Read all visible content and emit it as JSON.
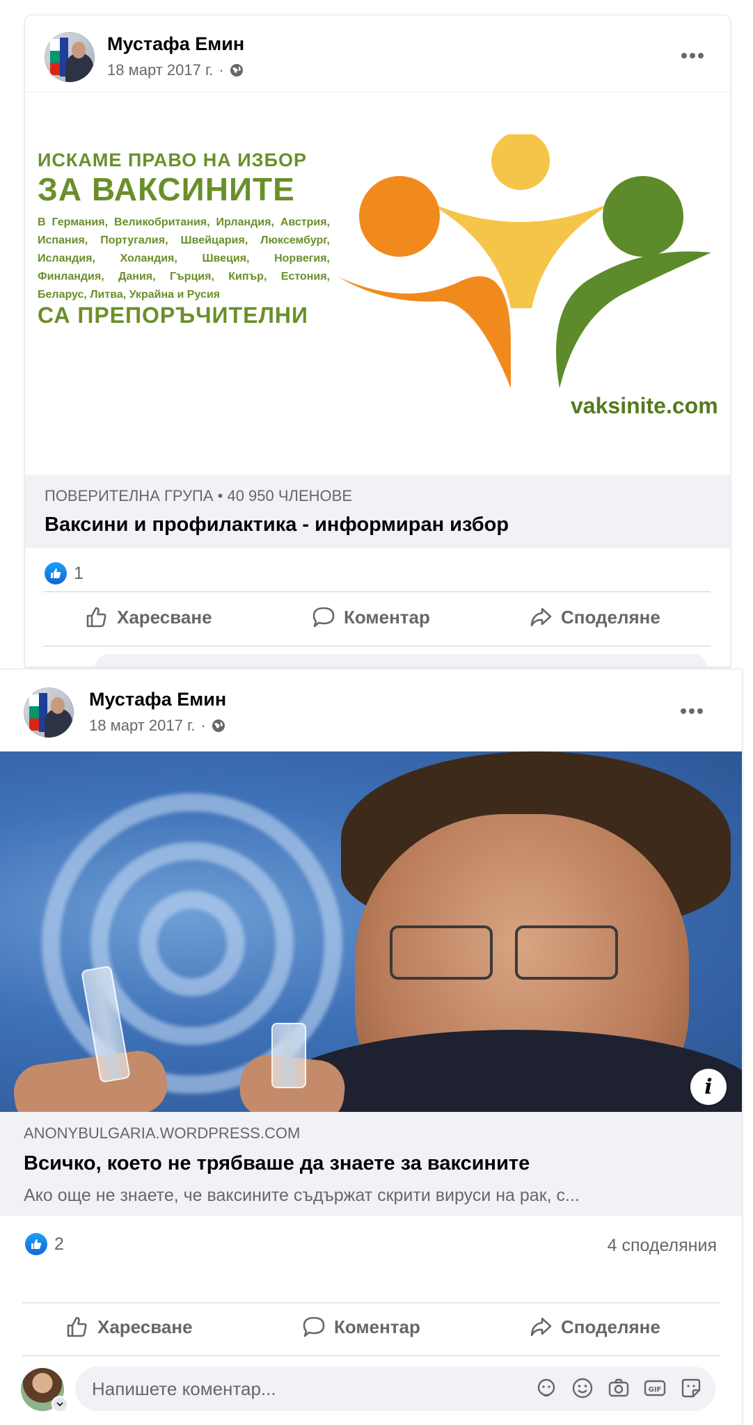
{
  "post1": {
    "author": "Мустафа Емин",
    "date": "18 март 2017 г.",
    "separator": "·",
    "banner": {
      "line1": "ИСКАМЕ  ПРАВО НА ИЗБОР",
      "line2": "ЗА ВАКСИНИТЕ",
      "countries": "В Германия, Великобритания, Ирландия, Австрия, Испания, Португалия, Швейцария, Люксембург, Исландия, Холандия, Швеция, Норвегия, Финландия, Дания, Гърция, Кипър, Естония, Беларус, Литва, Украйна и Русия",
      "line3": "СА ПРЕПОРЪЧИТЕЛНИ",
      "site": "vaksinite.com",
      "colors": {
        "orange": "#f08a1c",
        "yellow": "#f5c54a",
        "green": "#5d8a2a"
      }
    },
    "group_meta": "ПОВЕРИТЕЛНА ГРУПА  •  40 950 ЧЛЕНОВЕ",
    "group_title": "Ваксини и профилактика - информиран избор",
    "reaction_count": "1",
    "actions": {
      "like": "Харесване",
      "comment": "Коментар",
      "share": "Споделяне"
    }
  },
  "post2": {
    "author": "Мустафа Емин",
    "date": "18 март 2017 г.",
    "separator": "·",
    "link_site": "ANONYBULGARIA.WORDPRESS.COM",
    "link_title": "Всичко, което не трябваше да знаете за ваксините",
    "link_desc": "Ако още не знаете, че ваксините съдържат скрити вируси на рак, с...",
    "info_glyph": "i",
    "reaction_count": "2",
    "shares": "4 споделяния",
    "actions": {
      "like": "Харесване",
      "comment": "Коментар",
      "share": "Споделяне"
    },
    "comment_placeholder": "Напишете коментар...",
    "comment_icons": [
      "sticker-avatar-icon",
      "emoji-icon",
      "camera-icon",
      "gif-icon",
      "sticker-icon"
    ]
  },
  "theme": {
    "accent": "#1877f2",
    "muted_text": "#65676b",
    "surface": "#f0f2f5"
  }
}
